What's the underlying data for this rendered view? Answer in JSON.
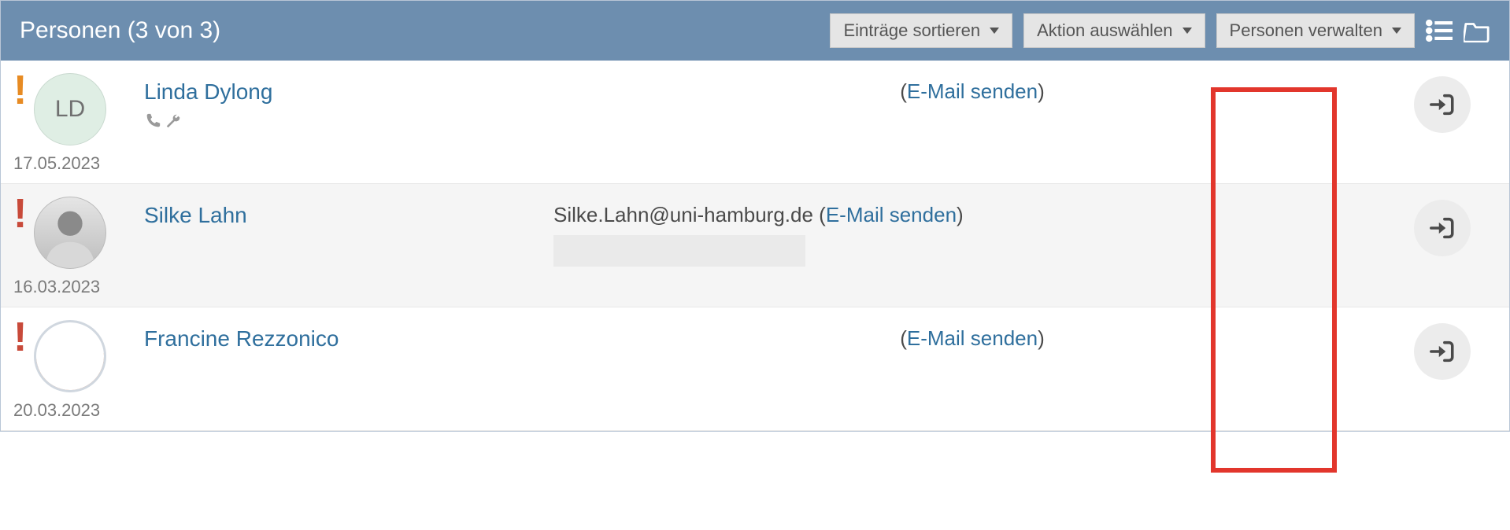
{
  "header": {
    "title": "Personen (3 von 3)",
    "buttons": {
      "sort": "Einträge sortieren",
      "action": "Aktion auswählen",
      "manage": "Personen verwalten"
    }
  },
  "rows": [
    {
      "flag_color": "orange",
      "avatar_initials": "LD",
      "date": "17.05.2023",
      "name": "Linda Dylong",
      "email_prefix": "",
      "email_link": "E-Mail senden",
      "show_meta_icons": true,
      "has_redact": false,
      "alt": false,
      "avatar_kind": "initials"
    },
    {
      "flag_color": "red",
      "avatar_initials": "",
      "date": "16.03.2023",
      "name": "Silke Lahn",
      "email_prefix": "Silke.Lahn@uni-hamburg.de ",
      "email_link": "E-Mail senden",
      "show_meta_icons": false,
      "has_redact": true,
      "alt": true,
      "avatar_kind": "photo"
    },
    {
      "flag_color": "red",
      "avatar_initials": "",
      "date": "20.03.2023",
      "name": "Francine Rezzonico",
      "email_prefix": "",
      "email_link": "E-Mail senden",
      "show_meta_icons": false,
      "has_redact": false,
      "alt": false,
      "avatar_kind": "ring"
    }
  ]
}
